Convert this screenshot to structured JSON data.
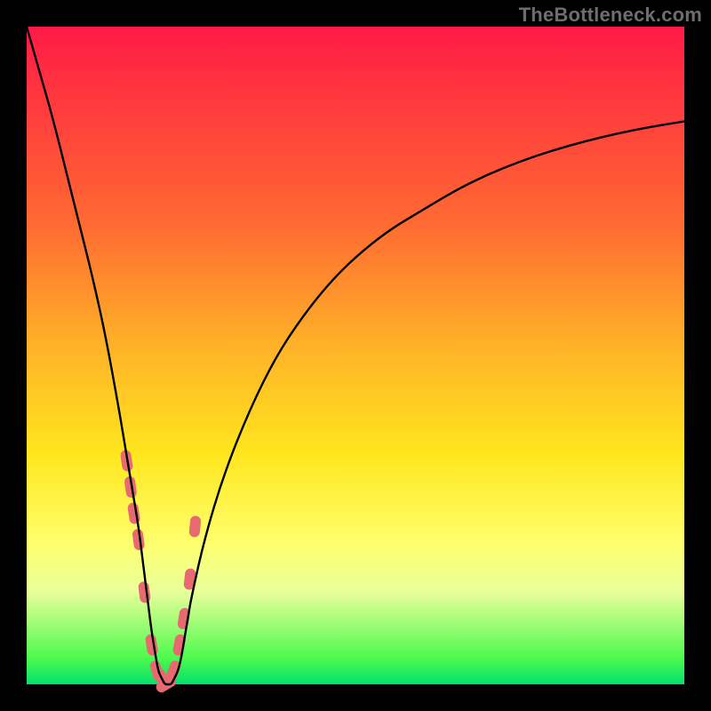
{
  "watermark": "TheBottleneck.com",
  "chart_data": {
    "type": "line",
    "title": "",
    "xlabel": "",
    "ylabel": "",
    "xlim": [
      0,
      100
    ],
    "ylim": [
      0,
      100
    ],
    "x": [
      0,
      2,
      4,
      6,
      8,
      10,
      12,
      14,
      15,
      16,
      17,
      17.5,
      18,
      18.5,
      19,
      19.5,
      20,
      20.5,
      21,
      21.5,
      22,
      22.5,
      23,
      23.5,
      24,
      24.5,
      25,
      27,
      30,
      34,
      38,
      42,
      46,
      50,
      55,
      60,
      65,
      70,
      75,
      80,
      85,
      90,
      95,
      100
    ],
    "values": [
      100,
      93,
      86,
      78,
      70,
      62,
      53,
      42,
      36,
      30,
      24,
      20,
      16,
      12,
      8,
      5,
      2,
      1,
      0,
      0,
      0,
      1,
      2,
      4,
      7,
      10,
      13,
      22,
      32,
      42,
      50,
      56,
      61,
      65,
      69,
      72,
      75,
      77.5,
      79.5,
      81.2,
      82.6,
      83.8,
      84.8,
      85.6
    ],
    "series": [
      {
        "name": "bottleneck-curve",
        "color": "#000000"
      }
    ],
    "markers": {
      "name": "highlighted-segment",
      "color": "#E66A70",
      "shape": "rounded-capsule",
      "points_x": [
        15.2,
        15.8,
        16.3,
        17.0,
        17.9,
        19.0,
        19.8,
        20.6,
        21.2,
        22.3,
        23.2,
        23.9,
        24.8,
        25.6
      ],
      "points_y": [
        34,
        30,
        26,
        22,
        14,
        6,
        2,
        1,
        0,
        2,
        6,
        10,
        16,
        24
      ]
    },
    "background_gradient": {
      "stops": [
        {
          "pos": 0.0,
          "color": "#FF1A48"
        },
        {
          "pos": 0.3,
          "color": "#FF6A32"
        },
        {
          "pos": 0.48,
          "color": "#FFB028"
        },
        {
          "pos": 0.65,
          "color": "#FFE61E"
        },
        {
          "pos": 0.86,
          "color": "#E8FF9A"
        },
        {
          "pos": 1.0,
          "color": "#02E06C"
        }
      ]
    },
    "grid": false,
    "legend": false
  }
}
